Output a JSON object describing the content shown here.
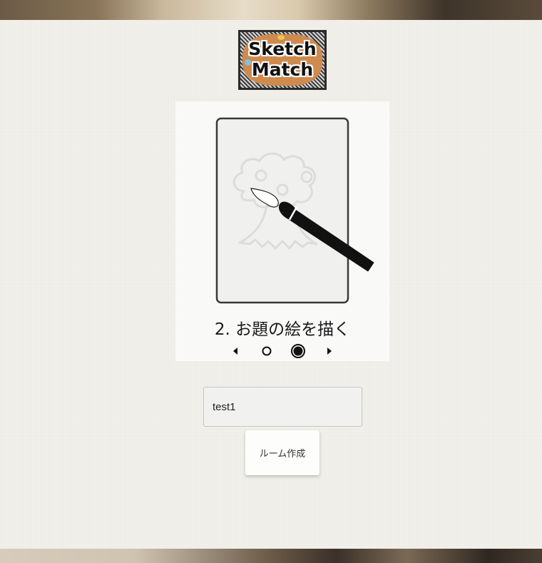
{
  "logo": {
    "line1": "Sketch",
    "line2": "Match"
  },
  "tutorial": {
    "step_caption": "2. お題の絵を描く",
    "current_step": 2,
    "total_steps": 2
  },
  "form": {
    "room_name_value": "test1",
    "create_room_label": "ルーム作成"
  },
  "colors": {
    "logo_orange": "#cf8a4e",
    "panel_bg": "#f9f9f8",
    "page_bg": "#f1f0ea",
    "brush_black": "#111111"
  }
}
